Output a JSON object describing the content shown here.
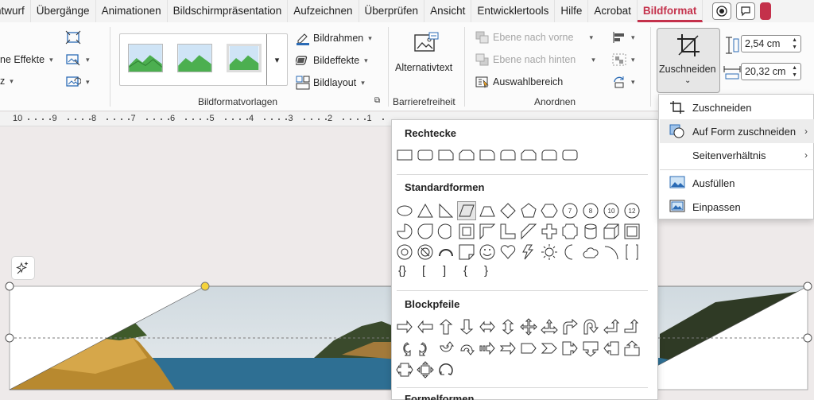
{
  "tabs": [
    "ntwurf",
    "Übergänge",
    "Animationen",
    "Bildschirmpräsentation",
    "Aufzeichnen",
    "Überprüfen",
    "Ansicht",
    "Entwicklertools",
    "Hilfe",
    "Acrobat",
    "Bildformat"
  ],
  "ribbon": {
    "left_partial": {
      "effekte": "ne Effekte",
      "z": "z"
    },
    "picture_styles_label": "Bildformatvorlagen",
    "bildrahmen": "Bildrahmen",
    "bildeffekte": "Bildeffekte",
    "bildlayout": "Bildlayout",
    "alttext": "Alternativtext",
    "barrierefreiheit_label": "Barrierefreiheit",
    "ebene_vorne": "Ebene nach vorne",
    "ebene_hinten": "Ebene nach hinten",
    "auswahlbereich": "Auswahlbereich",
    "anordnen_label": "Anordnen",
    "zuschneiden": "Zuschneiden",
    "height_value": "2,54 cm",
    "width_value": "20,32 cm"
  },
  "ruler": [
    "10",
    "9",
    "8",
    "7",
    "6",
    "5",
    "4",
    "3",
    "2",
    "1"
  ],
  "shapes_panel": {
    "sections": [
      "Rechtecke",
      "Standardformen",
      "Blockpfeile",
      "Formelformen"
    ],
    "standard_numbers": [
      "7",
      "8",
      "10",
      "12"
    ],
    "brackets": [
      "{}",
      "[",
      "]",
      "{",
      "}"
    ]
  },
  "crop_menu": {
    "items": [
      "Zuschneiden",
      "Auf Form zuschneiden",
      "Seitenverhältnis",
      "Ausfüllen",
      "Einpassen"
    ]
  },
  "colors": {
    "accent": "#c4314b",
    "handle_yellow": "#f5d33b",
    "sea": "#2e6f93"
  }
}
